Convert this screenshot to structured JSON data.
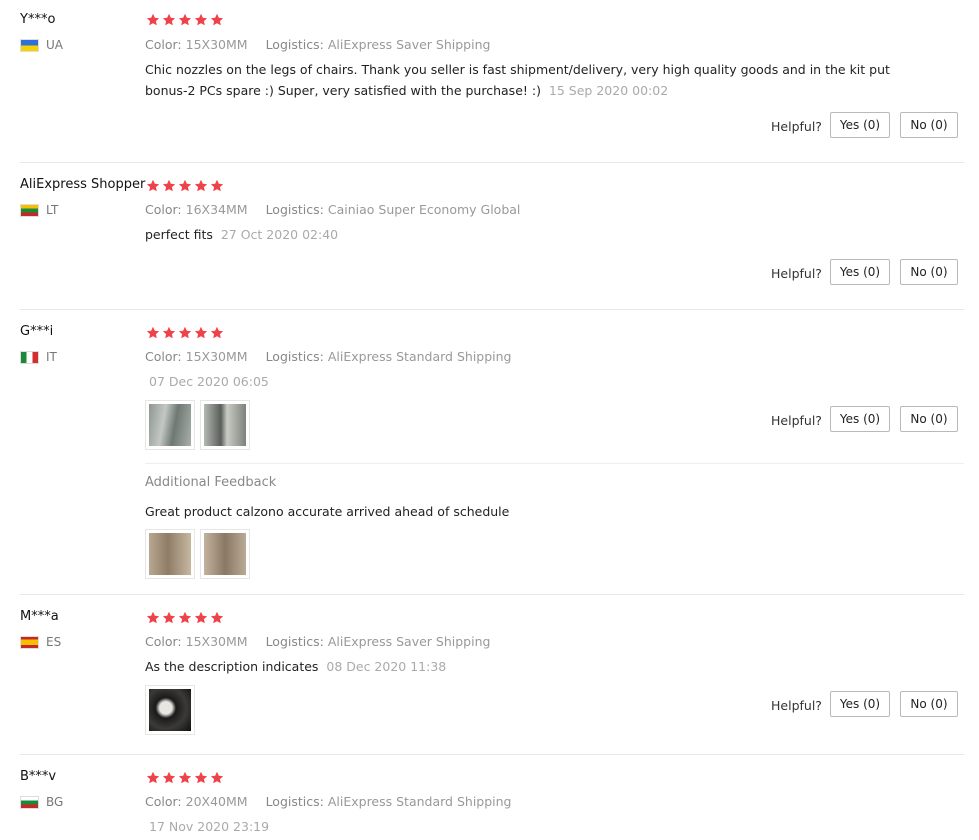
{
  "helpful_label": "Helpful?",
  "additional_feedback_title": "Additional Feedback",
  "star_color": "#f0424b",
  "reviews": [
    {
      "user": "Y***o",
      "country": "UA",
      "flag_colors": [
        "#2e6fd8",
        "#f5d300"
      ],
      "rating": 5,
      "color_label": "Color:",
      "color_value": "15X30MM",
      "logistics_label": "Logistics:",
      "logistics_value": "AliExpress Saver Shipping",
      "text_line1": "Chic nozzles on the legs of chairs. Thank you seller is fast shipment/delivery, very high quality goods and in the kit put",
      "text_line2": "bonus-2 PCs spare :) Super, very satisfied with the purchase! :)",
      "date": "15 Sep 2020 00:02",
      "yes": "Yes (0)",
      "no": "No (0)"
    },
    {
      "user": "AliExpress Shopper",
      "country": "LT",
      "flag_colors": [
        "#f6c000",
        "#1a8a3a",
        "#c62828"
      ],
      "rating": 5,
      "color_label": "Color:",
      "color_value": "16X34MM",
      "logistics_label": "Logistics:",
      "logistics_value": "Cainiao Super Economy Global",
      "text": "perfect fits",
      "date": "27 Oct 2020 02:40",
      "yes": "Yes (0)",
      "no": "No (0)"
    },
    {
      "user": "G***i",
      "country": "IT",
      "flag_colors": [
        "#1a8a3a",
        "#ffffff",
        "#d32f2f"
      ],
      "rating": 5,
      "color_label": "Color:",
      "color_value": "15X30MM",
      "logistics_label": "Logistics:",
      "logistics_value": "AliExpress Standard Shipping",
      "date": "07 Dec 2020 06:05",
      "photos": 2,
      "additional_text": "Great product calzono accurate arrived ahead of schedule",
      "additional_photos": 2,
      "yes": "Yes (0)",
      "no": "No (0)"
    },
    {
      "user": "M***a",
      "country": "ES",
      "flag_colors": [
        "#c62828",
        "#f6c000",
        "#c62828"
      ],
      "rating": 5,
      "color_label": "Color:",
      "color_value": "15X30MM",
      "logistics_label": "Logistics:",
      "logistics_value": "AliExpress Saver Shipping",
      "text": "As the description indicates",
      "date": "08 Dec 2020 11:38",
      "photos": 1,
      "yes": "Yes (0)",
      "no": "No (0)"
    },
    {
      "user": "B***v",
      "country": "BG",
      "flag_colors": [
        "#ffffff",
        "#1a8a3a",
        "#c62828"
      ],
      "rating": 5,
      "color_label": "Color:",
      "color_value": "20X40MM",
      "logistics_label": "Logistics:",
      "logistics_value": "AliExpress Standard Shipping",
      "date": "17 Nov 2020 23:19"
    }
  ]
}
